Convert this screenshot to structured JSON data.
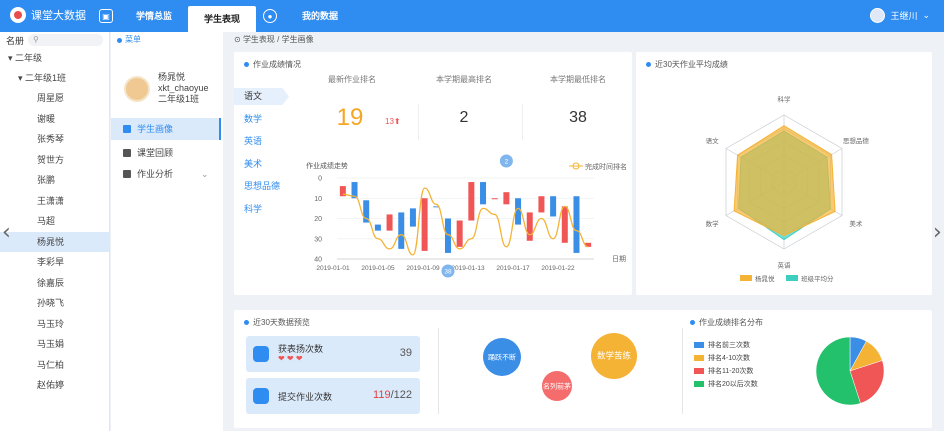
{
  "header": {
    "app_name": "课堂大数据",
    "tabs": [
      {
        "label": "学情总监"
      },
      {
        "label": "学生表现"
      },
      {
        "label": "我的数据"
      }
    ],
    "user_name": "王继川"
  },
  "left": {
    "roster_label": "名册",
    "grade": "二年级",
    "class": "二年级1班",
    "students": [
      "周星愿",
      "谢暖",
      "张秀琴",
      "贺世方",
      "张鹏",
      "王潇潇",
      "马超",
      "杨晁悦",
      "李彩旱",
      "徐嘉辰",
      "孙晓飞",
      "马玉玲",
      "马玉娟",
      "马仁柏",
      "赵佑婷"
    ],
    "selected_index": 7
  },
  "mid": {
    "menu_label": "菜单",
    "student_name": "杨晁悦",
    "student_id": "xkt_chaoyue",
    "student_class": "二年级1班",
    "items": [
      {
        "label": "学生画像"
      },
      {
        "label": "课堂回顾"
      },
      {
        "label": "作业分析"
      }
    ]
  },
  "breadcrumb": {
    "root": "学生表现",
    "sep": "/",
    "current": "学生画像"
  },
  "homework": {
    "title": "作业成绩情况",
    "subjects": [
      "语文",
      "数学",
      "英语",
      "美术",
      "思想品德",
      "科学"
    ],
    "active_subject": 0,
    "stats": [
      {
        "label": "最新作业排名",
        "value": "19",
        "delta": "13"
      },
      {
        "label": "本学期最高排名",
        "value": "2"
      },
      {
        "label": "本学期最低排名",
        "value": "38"
      }
    ]
  },
  "chart_data": [
    {
      "type": "candlestick",
      "title": "作业成绩走势",
      "legend": "完成时间排名",
      "xlabel": "日期",
      "x_ticks": [
        "2019-01-01",
        "2019-01-05",
        "2019-01-09",
        "2019-01-13",
        "2019-01-17",
        "2019-01-22"
      ],
      "ylim": [
        0,
        40
      ],
      "y_ticks": [
        0,
        10,
        20,
        30,
        40
      ],
      "markers": [
        {
          "label": "2",
          "x_index": 14
        },
        {
          "label": "38",
          "x_index": 9
        }
      ],
      "candles": [
        {
          "open": 9,
          "close": 4,
          "color": "#f05656"
        },
        {
          "open": 2,
          "close": 10,
          "color": "#3a8ee6"
        },
        {
          "open": 11,
          "close": 22,
          "color": "#3a8ee6"
        },
        {
          "open": 23,
          "close": 26,
          "color": "#3a8ee6"
        },
        {
          "open": 26,
          "close": 18,
          "color": "#f05656"
        },
        {
          "open": 17,
          "close": 35,
          "color": "#3a8ee6"
        },
        {
          "open": 15,
          "close": 24,
          "color": "#3a8ee6"
        },
        {
          "open": 36,
          "close": 10,
          "color": "#f05656"
        },
        {
          "open": 14,
          "close": 14,
          "color": "#3a8ee6"
        },
        {
          "open": 20,
          "close": 37,
          "color": "#3a8ee6"
        },
        {
          "open": 34,
          "close": 21,
          "color": "#f05656"
        },
        {
          "open": 2,
          "close": 21,
          "color": "#f05656"
        },
        {
          "open": 2,
          "close": 13,
          "color": "#3a8ee6"
        },
        {
          "open": 10,
          "close": 10,
          "color": "#f05656"
        },
        {
          "open": 13,
          "close": 7,
          "color": "#f05656"
        },
        {
          "open": 10,
          "close": 23,
          "color": "#3a8ee6"
        },
        {
          "open": 31,
          "close": 17,
          "color": "#f05656"
        },
        {
          "open": 17,
          "close": 9,
          "color": "#f05656"
        },
        {
          "open": 9,
          "close": 19,
          "color": "#3a8ee6"
        },
        {
          "open": 14,
          "close": 32,
          "color": "#f05656"
        },
        {
          "open": 9,
          "close": 37,
          "color": "#3a8ee6"
        },
        {
          "open": 32,
          "close": 34,
          "color": "#f05656"
        }
      ],
      "line": [
        8,
        9,
        20,
        30,
        35,
        28,
        38,
        5,
        13,
        28,
        35,
        30,
        15,
        18,
        34,
        15,
        28,
        20,
        30,
        14,
        26,
        34
      ]
    },
    {
      "type": "radar",
      "title": "近30天作业平均成绩",
      "axes": [
        "思想品德",
        "美术",
        "英语",
        "数学",
        "语文",
        "科学"
      ],
      "max": 100,
      "series": [
        {
          "name": "杨晁悦",
          "values": [
            82,
            88,
            80,
            86,
            80,
            84
          ],
          "color": "#f5b335"
        },
        {
          "name": "班级平均分",
          "values": [
            74,
            80,
            86,
            78,
            74,
            76
          ],
          "color": "#3ecfc0"
        }
      ]
    },
    {
      "type": "pie",
      "title": "作业成绩排名分布",
      "slices": [
        {
          "label": "排名前三次数",
          "value": 8,
          "color": "#3a8ee6"
        },
        {
          "label": "排名4-10次数",
          "value": 12,
          "color": "#f5b335"
        },
        {
          "label": "排名11-20次数",
          "value": 25,
          "color": "#f05656"
        },
        {
          "label": "排名20以后次数",
          "value": 55,
          "color": "#23c16b"
        }
      ]
    }
  ],
  "overview": {
    "title": "近30天数据预览",
    "praise": {
      "label": "获表扬次数",
      "value": "39",
      "hearts": "❤ ❤ ❤"
    },
    "submit": {
      "label": "提交作业次数",
      "value": "119",
      "sep": "/",
      "total": "122"
    },
    "bubbles": [
      {
        "label": "踊跃不断",
        "color": "#3a8ee6"
      },
      {
        "label": "数学苦练",
        "color": "#f5b335"
      },
      {
        "label": "名列前茅",
        "color": "#f56c6c"
      }
    ]
  }
}
